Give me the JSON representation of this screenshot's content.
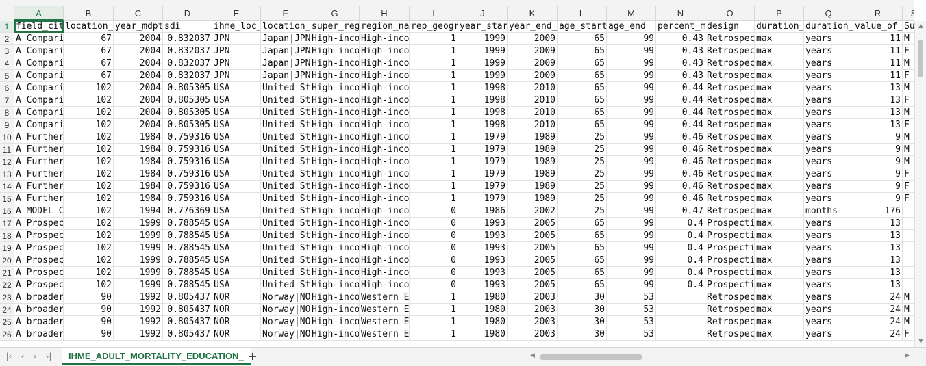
{
  "columns": [
    "A",
    "B",
    "C",
    "D",
    "E",
    "F",
    "G",
    "H",
    "I",
    "J",
    "K",
    "L",
    "M",
    "N",
    "O",
    "P",
    "Q",
    "R",
    "S"
  ],
  "active_column": "A",
  "active_row": "1",
  "rows": [
    {
      "n": "1",
      "c": [
        "field_cit",
        "location_",
        "year_mdpt",
        "sdi",
        "ihme_loc_",
        "location_",
        "super_reg",
        "region_na",
        "rep_geogr",
        "year_star",
        "year_end_",
        "age_start",
        "age_end",
        "percent_m",
        "design",
        "duration_",
        "duration_",
        "value_of_",
        "Su"
      ]
    },
    {
      "n": "2",
      "c": [
        "A Compari",
        "67",
        "2004",
        "0.832037",
        "JPN",
        "Japan|JPN",
        "High-inco",
        "High-inco",
        "1",
        "1999",
        "2009",
        "65",
        "99",
        "0.43",
        "Retrospec",
        "max",
        "years",
        "11",
        "M"
      ]
    },
    {
      "n": "3",
      "c": [
        "A Compari",
        "67",
        "2004",
        "0.832037",
        "JPN",
        "Japan|JPN",
        "High-inco",
        "High-inco",
        "1",
        "1999",
        "2009",
        "65",
        "99",
        "0.43",
        "Retrospec",
        "max",
        "years",
        "11",
        "F"
      ]
    },
    {
      "n": "4",
      "c": [
        "A Compari",
        "67",
        "2004",
        "0.832037",
        "JPN",
        "Japan|JPN",
        "High-inco",
        "High-inco",
        "1",
        "1999",
        "2009",
        "65",
        "99",
        "0.43",
        "Retrospec",
        "max",
        "years",
        "11",
        "M"
      ]
    },
    {
      "n": "5",
      "c": [
        "A Compari",
        "67",
        "2004",
        "0.832037",
        "JPN",
        "Japan|JPN",
        "High-inco",
        "High-inco",
        "1",
        "1999",
        "2009",
        "65",
        "99",
        "0.43",
        "Retrospec",
        "max",
        "years",
        "11",
        "F"
      ]
    },
    {
      "n": "6",
      "c": [
        "A Compari",
        "102",
        "2004",
        "0.805305",
        "USA",
        "United St",
        "High-inco",
        "High-inco",
        "1",
        "1998",
        "2010",
        "65",
        "99",
        "0.44",
        "Retrospec",
        "max",
        "years",
        "13",
        "M"
      ]
    },
    {
      "n": "7",
      "c": [
        "A Compari",
        "102",
        "2004",
        "0.805305",
        "USA",
        "United St",
        "High-inco",
        "High-inco",
        "1",
        "1998",
        "2010",
        "65",
        "99",
        "0.44",
        "Retrospec",
        "max",
        "years",
        "13",
        "F"
      ]
    },
    {
      "n": "8",
      "c": [
        "A Compari",
        "102",
        "2004",
        "0.805305",
        "USA",
        "United St",
        "High-inco",
        "High-inco",
        "1",
        "1998",
        "2010",
        "65",
        "99",
        "0.44",
        "Retrospec",
        "max",
        "years",
        "13",
        "M"
      ]
    },
    {
      "n": "9",
      "c": [
        "A Compari",
        "102",
        "2004",
        "0.805305",
        "USA",
        "United St",
        "High-inco",
        "High-inco",
        "1",
        "1998",
        "2010",
        "65",
        "99",
        "0.44",
        "Retrospec",
        "max",
        "years",
        "13",
        "F"
      ]
    },
    {
      "n": "10",
      "c": [
        "A Further",
        "102",
        "1984",
        "0.759316",
        "USA",
        "United St",
        "High-inco",
        "High-inco",
        "1",
        "1979",
        "1989",
        "25",
        "99",
        "0.46",
        "Retrospec",
        "max",
        "years",
        "9",
        "M"
      ]
    },
    {
      "n": "11",
      "c": [
        "A Further",
        "102",
        "1984",
        "0.759316",
        "USA",
        "United St",
        "High-inco",
        "High-inco",
        "1",
        "1979",
        "1989",
        "25",
        "99",
        "0.46",
        "Retrospec",
        "max",
        "years",
        "9",
        "M"
      ]
    },
    {
      "n": "12",
      "c": [
        "A Further",
        "102",
        "1984",
        "0.759316",
        "USA",
        "United St",
        "High-inco",
        "High-inco",
        "1",
        "1979",
        "1989",
        "25",
        "99",
        "0.46",
        "Retrospec",
        "max",
        "years",
        "9",
        "M"
      ]
    },
    {
      "n": "13",
      "c": [
        "A Further",
        "102",
        "1984",
        "0.759316",
        "USA",
        "United St",
        "High-inco",
        "High-inco",
        "1",
        "1979",
        "1989",
        "25",
        "99",
        "0.46",
        "Retrospec",
        "max",
        "years",
        "9",
        "F"
      ]
    },
    {
      "n": "14",
      "c": [
        "A Further",
        "102",
        "1984",
        "0.759316",
        "USA",
        "United St",
        "High-inco",
        "High-inco",
        "1",
        "1979",
        "1989",
        "25",
        "99",
        "0.46",
        "Retrospec",
        "max",
        "years",
        "9",
        "F"
      ]
    },
    {
      "n": "15",
      "c": [
        "A Further",
        "102",
        "1984",
        "0.759316",
        "USA",
        "United St",
        "High-inco",
        "High-inco",
        "1",
        "1979",
        "1989",
        "25",
        "99",
        "0.46",
        "Retrospec",
        "max",
        "years",
        "9",
        "F"
      ]
    },
    {
      "n": "16",
      "c": [
        "A MODEL C",
        "102",
        "1994",
        "0.776369",
        "USA",
        "United St",
        "High-inco",
        "High-inco",
        "0",
        "1986",
        "2002",
        "25",
        "99",
        "0.47",
        "Retrospec",
        "max",
        "months",
        "176",
        ""
      ]
    },
    {
      "n": "17",
      "c": [
        "A Prospec",
        "102",
        "1999",
        "0.788545",
        "USA",
        "United St",
        "High-inco",
        "High-inco",
        "0",
        "1993",
        "2005",
        "65",
        "99",
        "0.4",
        "Prospecti",
        "max",
        "years",
        "13",
        ""
      ]
    },
    {
      "n": "18",
      "c": [
        "A Prospec",
        "102",
        "1999",
        "0.788545",
        "USA",
        "United St",
        "High-inco",
        "High-inco",
        "0",
        "1993",
        "2005",
        "65",
        "99",
        "0.4",
        "Prospecti",
        "max",
        "years",
        "13",
        ""
      ]
    },
    {
      "n": "19",
      "c": [
        "A Prospec",
        "102",
        "1999",
        "0.788545",
        "USA",
        "United St",
        "High-inco",
        "High-inco",
        "0",
        "1993",
        "2005",
        "65",
        "99",
        "0.4",
        "Prospecti",
        "max",
        "years",
        "13",
        ""
      ]
    },
    {
      "n": "20",
      "c": [
        "A Prospec",
        "102",
        "1999",
        "0.788545",
        "USA",
        "United St",
        "High-inco",
        "High-inco",
        "0",
        "1993",
        "2005",
        "65",
        "99",
        "0.4",
        "Prospecti",
        "max",
        "years",
        "13",
        ""
      ]
    },
    {
      "n": "21",
      "c": [
        "A Prospec",
        "102",
        "1999",
        "0.788545",
        "USA",
        "United St",
        "High-inco",
        "High-inco",
        "0",
        "1993",
        "2005",
        "65",
        "99",
        "0.4",
        "Prospecti",
        "max",
        "years",
        "13",
        ""
      ]
    },
    {
      "n": "22",
      "c": [
        "A Prospec",
        "102",
        "1999",
        "0.788545",
        "USA",
        "United St",
        "High-inco",
        "High-inco",
        "0",
        "1993",
        "2005",
        "65",
        "99",
        "0.4",
        "Prospecti",
        "max",
        "years",
        "13",
        ""
      ]
    },
    {
      "n": "23",
      "c": [
        "A broader",
        "90",
        "1992",
        "0.805437",
        "NOR",
        "Norway|NO",
        "High-inco",
        "Western E",
        "1",
        "1980",
        "2003",
        "30",
        "53",
        "",
        "Retrospec",
        "max",
        "years",
        "24",
        "M"
      ]
    },
    {
      "n": "24",
      "c": [
        "A broader",
        "90",
        "1992",
        "0.805437",
        "NOR",
        "Norway|NO",
        "High-inco",
        "Western E",
        "1",
        "1980",
        "2003",
        "30",
        "53",
        "",
        "Retrospec",
        "max",
        "years",
        "24",
        "M"
      ]
    },
    {
      "n": "25",
      "c": [
        "A broader",
        "90",
        "1992",
        "0.805437",
        "NOR",
        "Norway|NO",
        "High-inco",
        "Western E",
        "1",
        "1980",
        "2003",
        "30",
        "53",
        "",
        "Retrospec",
        "max",
        "years",
        "24",
        "M"
      ]
    },
    {
      "n": "26",
      "c": [
        "A broader",
        "90",
        "1992",
        "0.805437",
        "NOR",
        "Norway|NO",
        "High-inco",
        "Western E",
        "1",
        "1980",
        "2003",
        "30",
        "53",
        "",
        "Retrospec",
        "max",
        "years",
        "24",
        "F"
      ]
    }
  ],
  "sheet_tab": "IHME_ADULT_MORTALITY_EDUCATION_",
  "icons": {
    "first_sheet": "|‹",
    "prev_sheet": "‹",
    "next_sheet": "›",
    "last_sheet": "›|",
    "add_sheet": "+",
    "scroll_up": "▲",
    "scroll_down": "▼",
    "scroll_left": "◀",
    "scroll_right": "▶"
  },
  "colors": {
    "accent": "#217346"
  }
}
